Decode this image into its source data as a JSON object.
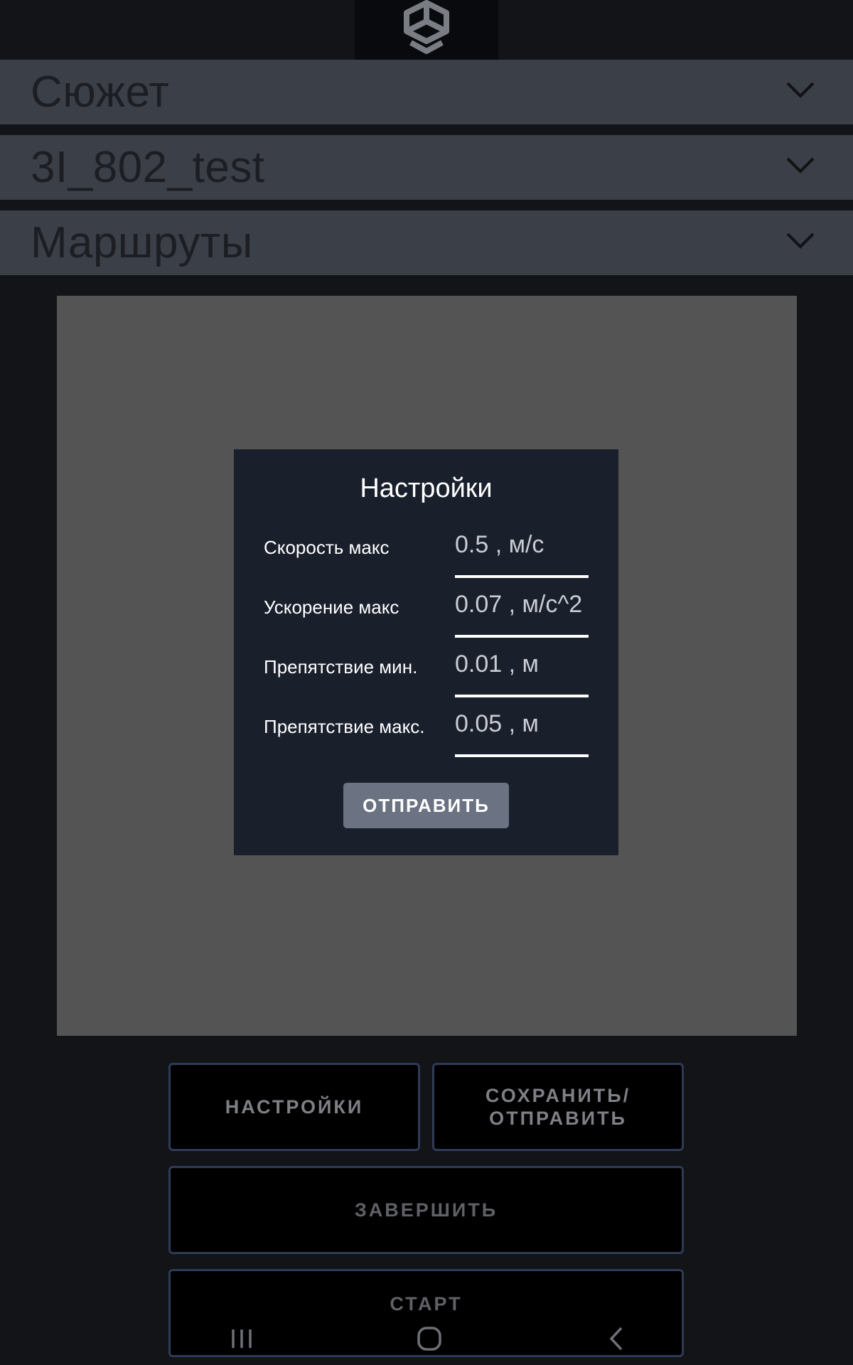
{
  "header": {
    "logo_icon": "cube-logo-icon"
  },
  "dropdowns": [
    {
      "label": "Сюжет",
      "icon": "chevron-down-icon"
    },
    {
      "label": "3I_802_test",
      "icon": "chevron-down-icon"
    },
    {
      "label": "Маршруты",
      "icon": "chevron-down-icon"
    }
  ],
  "dialog": {
    "title": "Настройки",
    "fields": [
      {
        "label": "Скорость макс",
        "value": "0.5 , м/с"
      },
      {
        "label": "Ускорение макс",
        "value": "0.07 , м/с^2"
      },
      {
        "label": "Препятствие мин.",
        "value": "0.01 , м"
      },
      {
        "label": "Препятствие макс.",
        "value": "0.05 , м"
      }
    ],
    "submit_label": "ОТПРАВИТЬ"
  },
  "buttons": {
    "settings": "НАСТРОЙКИ",
    "save_send": "СОХРАНИТЬ/ ОТПРАВИТЬ",
    "finish": "ЗАВЕРШИТЬ",
    "start": "СТАРТ"
  },
  "navbar": {
    "recent_icon": "recent-apps-icon",
    "home_icon": "home-icon",
    "back_icon": "back-icon"
  },
  "colors": {
    "background": "#121418",
    "dropdown": "#3b3f47",
    "map": "#545454",
    "dialog": "#1a1f2c",
    "submit": "#6b7282",
    "button_border": "#2f3b56"
  }
}
